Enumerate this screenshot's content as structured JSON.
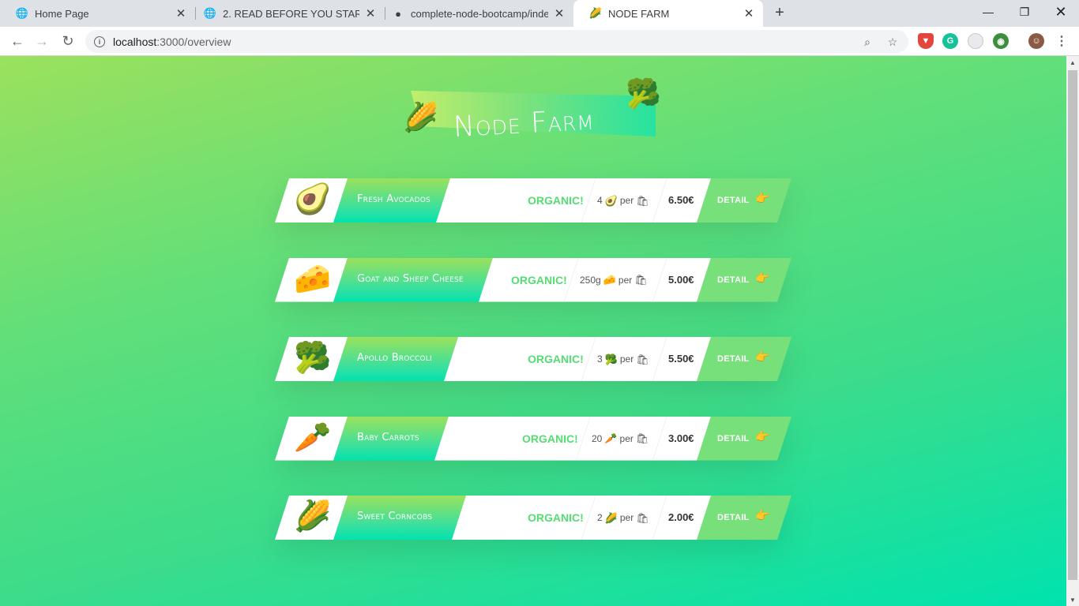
{
  "browser": {
    "tabs": [
      {
        "title": "Home Page",
        "icon": "globe-icon",
        "icon_glyph": "🌐"
      },
      {
        "title": "2. READ BEFORE YOU START!.htm",
        "icon": "globe-icon",
        "icon_glyph": "🌐"
      },
      {
        "title": "complete-node-bootcamp/index",
        "icon": "github-icon",
        "icon_glyph": "●"
      },
      {
        "title": "NODE FARM",
        "icon": "corn-icon",
        "icon_glyph": "🌽"
      }
    ],
    "url_host": "localhost",
    "url_path": ":3000/overview"
  },
  "page": {
    "title": "Node Farm",
    "title_emoji_left": "🌽",
    "title_emoji_right": "🥦"
  },
  "products": [
    {
      "emoji": "🥑",
      "name": "Fresh Avocados",
      "organic": "ORGANIC!",
      "quantity": "4",
      "per": "per",
      "price": "6.50€",
      "detail": "DETAIL"
    },
    {
      "emoji": "🧀",
      "name": "Goat and Sheep Cheese",
      "organic": "ORGANIC!",
      "quantity": "250g",
      "per": "per",
      "price": "5.00€",
      "detail": "DETAIL"
    },
    {
      "emoji": "🥦",
      "name": "Apollo Broccoli",
      "organic": "ORGANIC!",
      "quantity": "3",
      "per": "per",
      "price": "5.50€",
      "detail": "DETAIL"
    },
    {
      "emoji": "🥕",
      "name": "Baby Carrots",
      "organic": "ORGANIC!",
      "quantity": "20",
      "per": "per",
      "price": "3.00€",
      "detail": "DETAIL"
    },
    {
      "emoji": "🌽",
      "name": "Sweet Corncobs",
      "organic": "ORGANIC!",
      "quantity": "2",
      "per": "per",
      "price": "2.00€",
      "detail": "DETAIL"
    }
  ],
  "icons": {
    "bag_glyph": "🛍",
    "hand_glyph": "👉"
  },
  "colors": {
    "gradient_start": "#9be15d",
    "gradient_end": "#00e3ae",
    "organic_text": "#55dd74",
    "detail_bg": "#77e07a"
  }
}
